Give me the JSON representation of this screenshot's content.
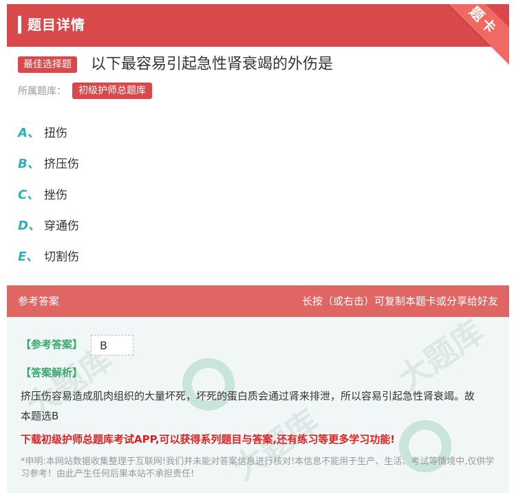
{
  "header": {
    "title": "题目详情",
    "corner_tag": "题卡"
  },
  "question": {
    "type_badge": "最佳选择题",
    "title": "以下最容易引起急性肾衰竭的外伤是",
    "bank_label": "所属题库：",
    "bank_name": "初级护师总题库"
  },
  "options": [
    {
      "letter": "A、",
      "text": "扭伤"
    },
    {
      "letter": "B、",
      "text": "挤压伤"
    },
    {
      "letter": "C、",
      "text": "挫伤"
    },
    {
      "letter": "D、",
      "text": "穿通伤"
    },
    {
      "letter": "E、",
      "text": "切割伤"
    }
  ],
  "answer_section": {
    "header_left": "参考答案",
    "header_right": "长按（或右击）可复制本题卡或分享给好友",
    "answer_label": "【参考答案】",
    "answer_value": "B",
    "analysis_label": "【答案解析】",
    "analysis_text": "挤压伤容易造成肌肉组织的大量坏死，坏死的蛋白质会通过肾来排泄，所以容易引起急性肾衰竭。故本题选B",
    "promo": "下载初级护师总题库考试APP,可以获得系列题目与答案,还有练习等更多学习功能!",
    "disclaimer": "*申明:本网站数据收集整理于互联网!我们并未能对答案信息进行核对!本信息不能用于生产、生活、考试等情境中,仅供学习参考！由此产生任何后果本站不承担责任!",
    "watermark": "大题库"
  },
  "colors": {
    "header_red": "#d9484a",
    "answer_header": "#e06664",
    "option_letter": "#2bb0bd",
    "answer_green": "#3aa76d",
    "promo_red": "#e02020",
    "answer_bg": "#f1f7f6"
  }
}
